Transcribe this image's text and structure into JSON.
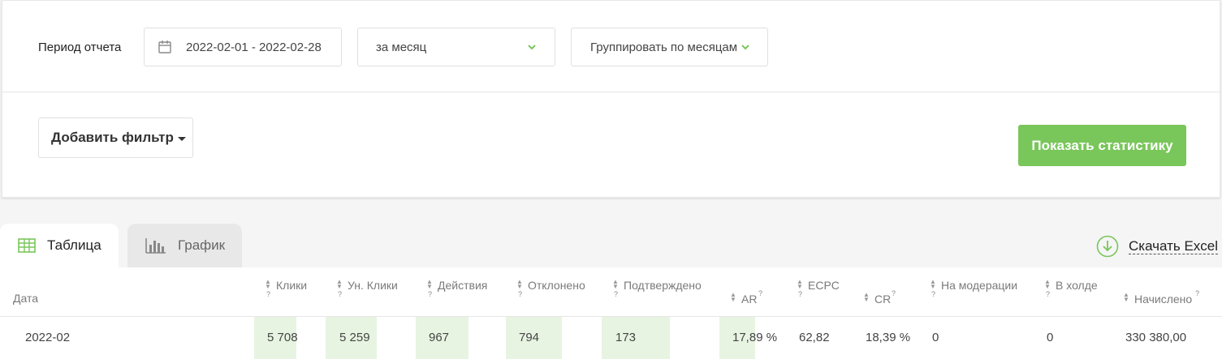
{
  "filters": {
    "period_label": "Период отчета",
    "date_range": "2022-02-01 - 2022-02-28",
    "period_select": "за месяц",
    "group_select": "Группировать по месяцам",
    "add_filter": "Добавить фильтр",
    "show_stats": "Показать статистику"
  },
  "tabs": [
    {
      "label": "Таблица",
      "active": true
    },
    {
      "label": "График",
      "active": false
    }
  ],
  "download_label": "Скачать Excel",
  "table": {
    "headers": {
      "date": "Дата",
      "clicks": "Клики",
      "unique_clicks": "Ун. Клики",
      "actions": "Действия",
      "rejected": "Отклонено",
      "confirmed": "Подтверждено",
      "ar": "AR",
      "ecpc": "ECPC",
      "cr": "CR",
      "moderation": "На модерации",
      "hold": "В холде",
      "accrued": "Начислено"
    },
    "help_mark": "?",
    "rows": [
      {
        "date": "2022-02",
        "clicks": "5 708",
        "unique_clicks": "5 259",
        "actions": "967",
        "rejected": "794",
        "confirmed": "173",
        "ar": "17,89 %",
        "ecpc": "62,82",
        "cr": "18,39 %",
        "moderation": "0",
        "hold": "0",
        "accrued": "330 380,00"
      }
    ]
  },
  "colors": {
    "accent": "#79c65a",
    "highlight": "#e8f4e2",
    "tab_inactive": "#e8e8e8"
  }
}
